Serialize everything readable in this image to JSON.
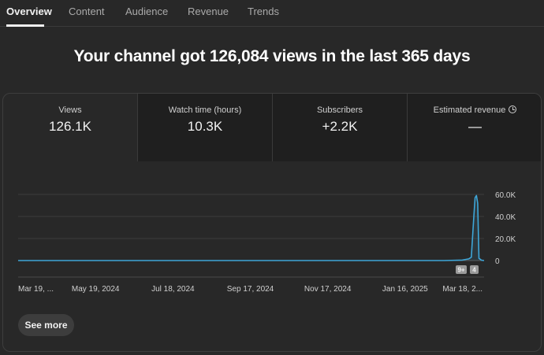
{
  "tabs": [
    {
      "label": "Overview",
      "active": true
    },
    {
      "label": "Content",
      "active": false
    },
    {
      "label": "Audience",
      "active": false
    },
    {
      "label": "Revenue",
      "active": false
    },
    {
      "label": "Trends",
      "active": false
    }
  ],
  "headline": "Your channel got 126,084 views in the last 365 days",
  "metrics": [
    {
      "label": "Views",
      "value": "126.1K",
      "selected": true
    },
    {
      "label": "Watch time (hours)",
      "value": "10.3K",
      "selected": false
    },
    {
      "label": "Subscribers",
      "value": "+2.2K",
      "selected": false
    },
    {
      "label": "Estimated revenue",
      "value": "—",
      "selected": false,
      "icon": "clock-icon"
    }
  ],
  "chart_data": {
    "type": "line",
    "series": [
      {
        "color": "#3ea6d8",
        "points": [
          [
            "2024-03-19",
            0
          ],
          [
            "2025-02-15",
            0
          ],
          [
            "2025-03-01",
            400
          ],
          [
            "2025-03-06",
            1500
          ],
          [
            "2025-03-08",
            3000
          ],
          [
            "2025-03-10",
            40000
          ],
          [
            "2025-03-11",
            57000
          ],
          [
            "2025-03-12",
            59000
          ],
          [
            "2025-03-13",
            52000
          ],
          [
            "2025-03-14",
            2000
          ],
          [
            "2025-03-16",
            300
          ],
          [
            "2025-03-18",
            0
          ]
        ]
      }
    ],
    "x_ticks": [
      "Mar 19, ...",
      "May 19, 2024",
      "Jul 18, 2024",
      "Sep 17, 2024",
      "Nov 17, 2024",
      "Jan 16, 2025",
      "Mar 18, 2..."
    ],
    "y_ticks": [
      "0",
      "20.0K",
      "40.0K",
      "60.0K"
    ],
    "ylim": [
      0,
      60000
    ],
    "grid": true,
    "markers": [
      {
        "label": "9+"
      },
      {
        "label": "4"
      }
    ]
  },
  "see_more_label": "See more"
}
